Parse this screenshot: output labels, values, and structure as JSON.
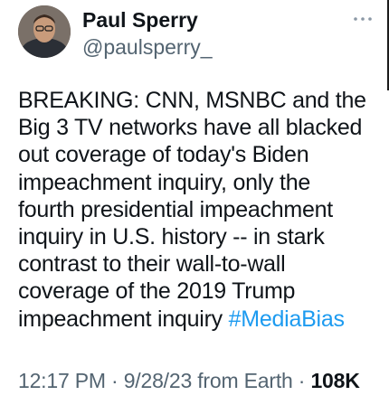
{
  "author": {
    "name": "Paul Sperry",
    "handle": "@paulsperry_"
  },
  "more_icon": "more-horizontal-icon",
  "tweet": {
    "text": "BREAKING: CNN, MSNBC and the\nBig 3 TV networks have all blacked\nout coverage of today's Biden\nimpeachment inquiry, only the\nfourth presidential impeachment\ninquiry in U.S. history -- in stark\ncontrast to their wall-to-wall\ncoverage of the 2019 Trump\nimpeachment inquiry ",
    "hashtag": "#MediaBias"
  },
  "meta": {
    "time": "12:17 PM",
    "separator": " · ",
    "date": "9/28/23",
    "source": " from Earth",
    "views": "108K"
  },
  "colors": {
    "text": "#0f1419",
    "secondary": "#536471",
    "hashtag": "#1d9bf0"
  }
}
